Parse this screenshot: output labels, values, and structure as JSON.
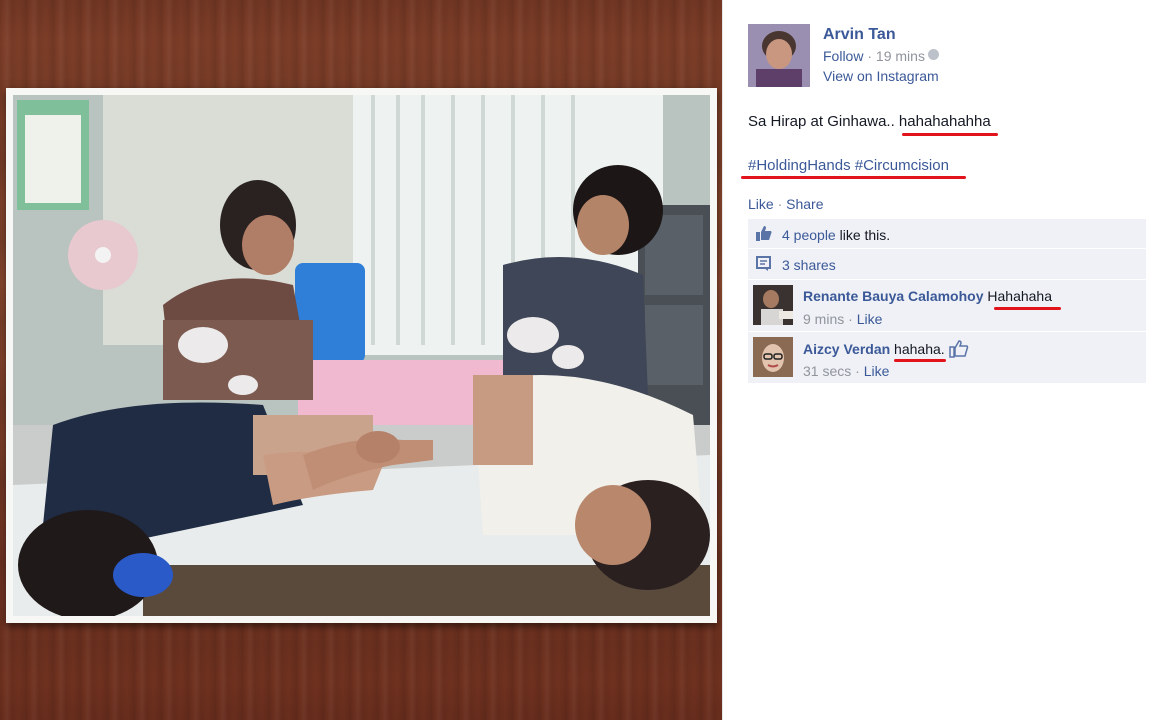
{
  "post": {
    "author": "Arvin Tan",
    "follow": "Follow",
    "time_sep": " · ",
    "time": "19 mins",
    "view_on": "View on Instagram",
    "caption_prefix": "Sa Hirap at Ginhawa.. ",
    "caption_laugh": "hahahahahha",
    "hashtag1": "#HoldingHands",
    "hashtag2": "#Circumcision",
    "like": "Like",
    "share": "Share",
    "action_sep": " · "
  },
  "ufi": {
    "likes_link": "4 people",
    "likes_rest": " like this.",
    "shares": "3 shares"
  },
  "comments": [
    {
      "name": "Renante Bauya Calamohoy",
      "text": "Hahahaha",
      "time": "9 mins",
      "sep": " · ",
      "like": "Like"
    },
    {
      "name": "Aizcy Verdan",
      "text": "hahaha.",
      "time": "31 secs",
      "sep": " · ",
      "like": "Like"
    }
  ],
  "colors": {
    "link": "#3b5998",
    "annotation": "#e3131b",
    "ufi_bg": "#eff1f6"
  }
}
